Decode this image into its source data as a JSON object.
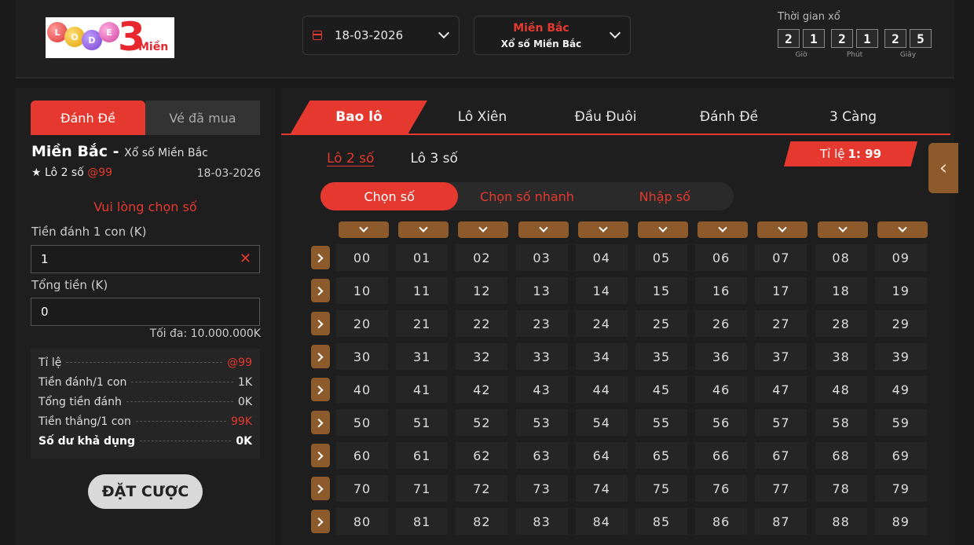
{
  "header": {
    "logo": {
      "letters": [
        "L",
        "O",
        "D",
        "E"
      ],
      "number": "3",
      "word": "Miền"
    },
    "date": "18-03-2026",
    "region_title": "Miền Bắc",
    "region_sub": "Xổ số Miền Bắc",
    "timer": {
      "title": "Thời gian xổ",
      "hours": [
        "2",
        "1"
      ],
      "minutes": [
        "2",
        "1"
      ],
      "seconds": [
        "2",
        "5"
      ],
      "hours_label": "Giờ",
      "minutes_label": "Phút",
      "seconds_label": "Giây"
    }
  },
  "left": {
    "tabs": [
      "Đánh Đề",
      "Vé đã mua"
    ],
    "region": "Miền Bắc -",
    "region_sub": "Xổ số Miền Bắc",
    "bet_type": "★ Lô 2 số",
    "bet_rate": "@99",
    "bet_date": "18-03-2026",
    "notice": "Vui lòng chọn số",
    "amount_label": "Tiền đánh 1 con (K)",
    "amount_value": "1",
    "total_label": "Tổng tiền (K)",
    "total_value": "0",
    "max": "Tối đa: 10.000.000K",
    "summary": [
      {
        "label": "Tỉ lệ",
        "value": "@99",
        "red": true
      },
      {
        "label": "Tiền đánh/1 con",
        "value": "1K"
      },
      {
        "label": "Tổng tiền đánh",
        "value": "0K"
      },
      {
        "label": "Tiền thắng/1 con",
        "value": "99K",
        "red": true
      },
      {
        "label": "Số dư khả dụng",
        "value": "0K",
        "bold": true
      }
    ],
    "place_bet": "ĐẶT CƯỢC"
  },
  "main": {
    "tabs": [
      "Bao lô",
      "Lô Xiên",
      "Đầu Đuôi",
      "Đánh Đề",
      "3 Càng"
    ],
    "subtabs": [
      "Lô 2 số",
      "Lô 3 số"
    ],
    "ratio_label": "Tỉ lệ",
    "ratio_value": "1: 99",
    "modes": [
      "Chọn số",
      "Chọn số nhanh",
      "Nhập số"
    ],
    "numbers": [
      [
        "00",
        "01",
        "02",
        "03",
        "04",
        "05",
        "06",
        "07",
        "08",
        "09"
      ],
      [
        "10",
        "11",
        "12",
        "13",
        "14",
        "15",
        "16",
        "17",
        "18",
        "19"
      ],
      [
        "20",
        "21",
        "22",
        "23",
        "24",
        "25",
        "26",
        "27",
        "28",
        "29"
      ],
      [
        "30",
        "31",
        "32",
        "33",
        "34",
        "35",
        "36",
        "37",
        "38",
        "39"
      ],
      [
        "40",
        "41",
        "42",
        "43",
        "44",
        "45",
        "46",
        "47",
        "48",
        "49"
      ],
      [
        "50",
        "51",
        "52",
        "53",
        "54",
        "55",
        "56",
        "57",
        "58",
        "59"
      ],
      [
        "60",
        "61",
        "62",
        "63",
        "64",
        "65",
        "66",
        "67",
        "68",
        "69"
      ],
      [
        "70",
        "71",
        "72",
        "73",
        "74",
        "75",
        "76",
        "77",
        "78",
        "79"
      ],
      [
        "80",
        "81",
        "82",
        "83",
        "84",
        "85",
        "86",
        "87",
        "88",
        "89"
      ]
    ]
  },
  "colors": {
    "accent": "#e5392f",
    "brown": "#8c5a2b",
    "bg": "#1a1a1a"
  }
}
